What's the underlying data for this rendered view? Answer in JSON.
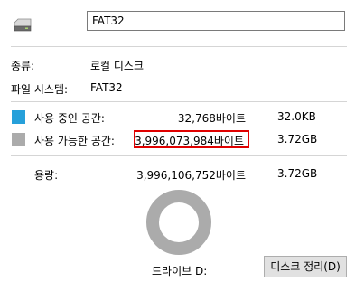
{
  "header": {
    "name_value": "FAT32"
  },
  "info": {
    "type_label": "종류:",
    "type_value": "로컬 디스크",
    "fs_label": "파일 시스템:",
    "fs_value": "FAT32"
  },
  "used": {
    "label": "사용 중인 공간:",
    "bytes": "32,768바이트",
    "short": "32.0KB",
    "color": "#26a0da"
  },
  "free": {
    "label": "사용 가능한 공간:",
    "bytes": "3,996,073,984바이트",
    "short": "3.72GB",
    "color": "#ababab"
  },
  "capacity": {
    "label": "용량:",
    "bytes": "3,996,106,752바이트",
    "short": "3.72GB"
  },
  "chart": {
    "used_fraction": 8.2e-06,
    "drive_label": "드라이브 D:"
  },
  "cleanup_button": "디스크 정리(D)",
  "highlight_color": "#e00000"
}
